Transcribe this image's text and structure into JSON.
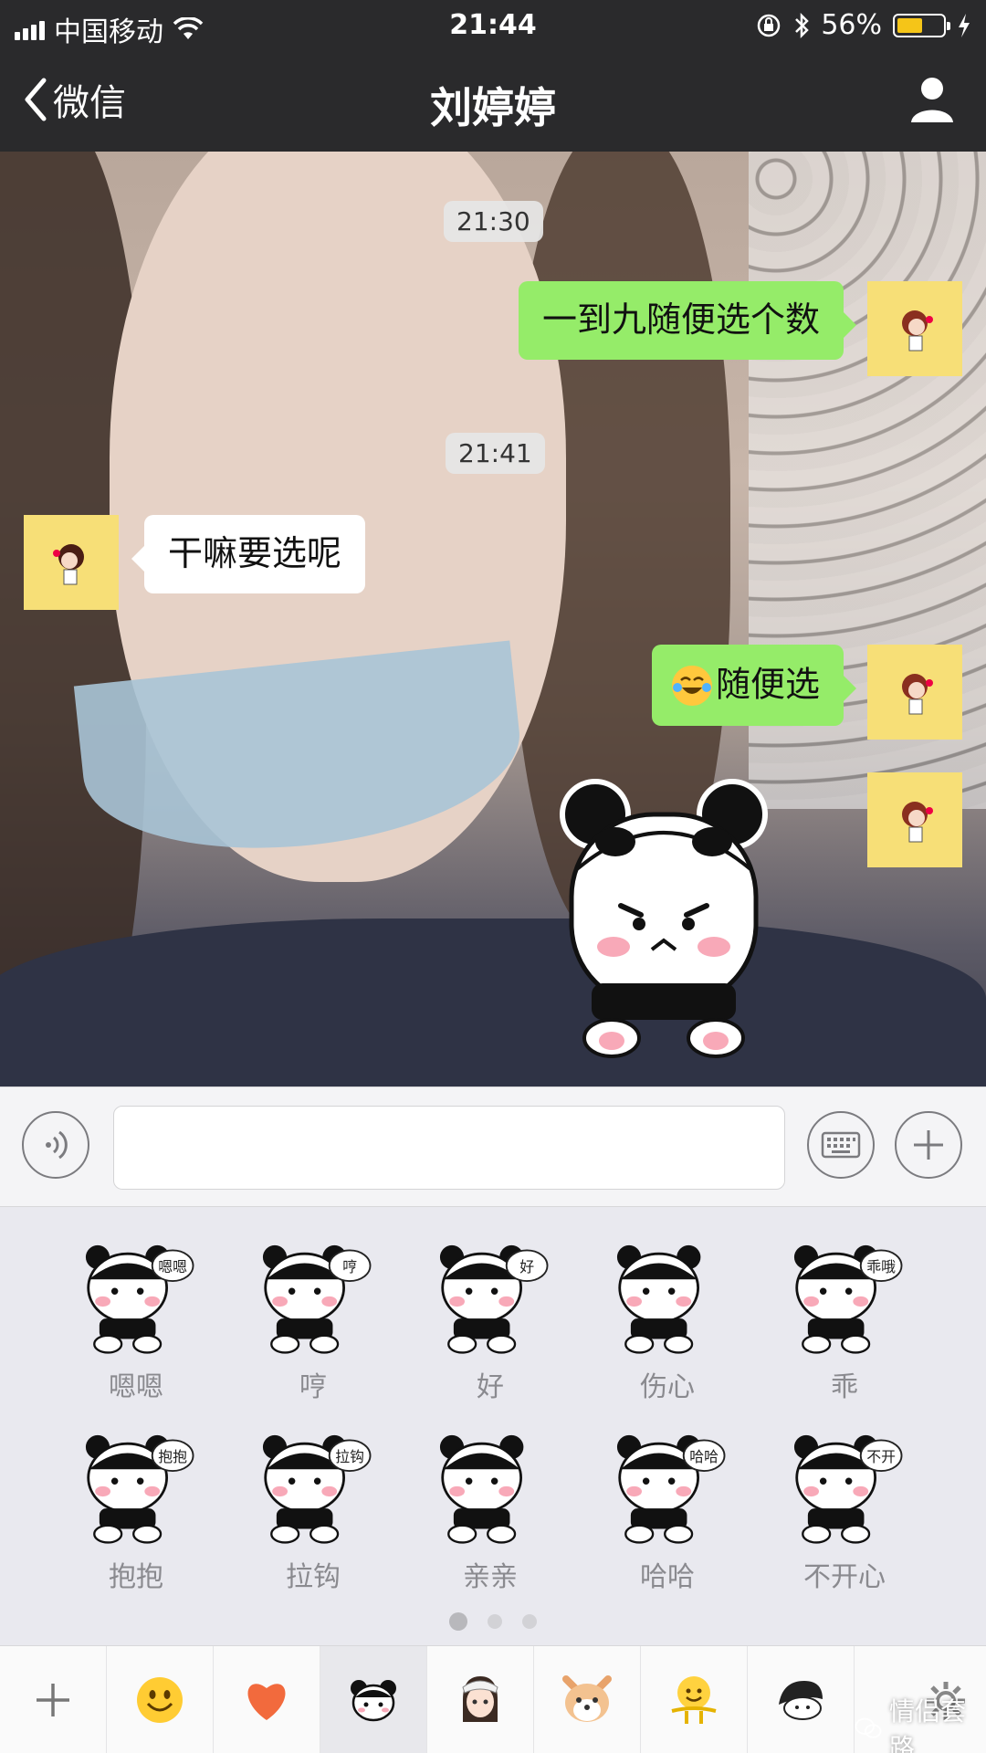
{
  "status_bar": {
    "carrier": "中国移动",
    "time": "21:44",
    "battery": "56%",
    "battery_level": 0.56
  },
  "nav": {
    "back_label": "微信",
    "title": "刘婷婷"
  },
  "messages": {
    "stamp_1": "21:30",
    "msg_1": "一到九随便选个数",
    "stamp_2": "21:41",
    "msg_2": "干嘛要选呢",
    "msg_3": "随便选"
  },
  "stickers": [
    {
      "label": "嗯嗯",
      "tag": "嗯嗯"
    },
    {
      "label": "哼",
      "tag": "哼"
    },
    {
      "label": "好",
      "tag": "好"
    },
    {
      "label": "伤心",
      "tag": ""
    },
    {
      "label": "乖",
      "tag": "乖哦"
    },
    {
      "label": "抱抱",
      "tag": "抱抱"
    },
    {
      "label": "拉钩",
      "tag": "拉钩"
    },
    {
      "label": "亲亲",
      "tag": ""
    },
    {
      "label": "哈哈",
      "tag": "哈哈哈"
    },
    {
      "label": "不开心",
      "tag": "不开心~"
    }
  ],
  "page_indicator": {
    "pages": 3,
    "current": 1
  },
  "watermark": "情侣套路",
  "colors": {
    "sent_bubble": "#95ec69",
    "received_bubble": "#ffffff",
    "avatar_bg": "#f7df77",
    "nav_bg": "#2a2a2c"
  }
}
